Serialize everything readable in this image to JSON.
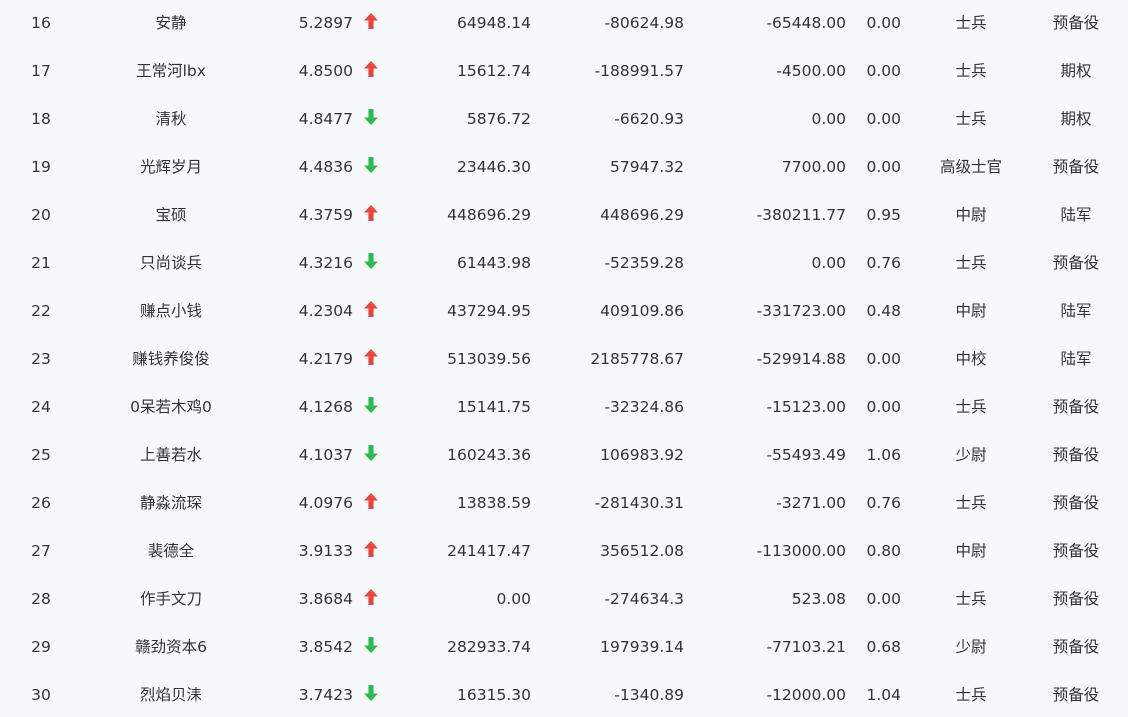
{
  "colors": {
    "up": "#e8473f",
    "down": "#2dbb4e",
    "text": "#333333",
    "background": "#f7f8fa"
  },
  "rows": [
    {
      "rank": "16",
      "name": "安静",
      "score": "5.2897",
      "trend": "up",
      "v1": "64948.14",
      "v2": "-80624.98",
      "v3": "-65448.00",
      "ratio": "0.00",
      "level": "士兵",
      "type": "预备役"
    },
    {
      "rank": "17",
      "name": "王常河lbx",
      "score": "4.8500",
      "trend": "up",
      "v1": "15612.74",
      "v2": "-188991.57",
      "v3": "-4500.00",
      "ratio": "0.00",
      "level": "士兵",
      "type": "期权"
    },
    {
      "rank": "18",
      "name": "清秋",
      "score": "4.8477",
      "trend": "down",
      "v1": "5876.72",
      "v2": "-6620.93",
      "v3": "0.00",
      "ratio": "0.00",
      "level": "士兵",
      "type": "期权"
    },
    {
      "rank": "19",
      "name": "光辉岁月",
      "score": "4.4836",
      "trend": "down",
      "v1": "23446.30",
      "v2": "57947.32",
      "v3": "7700.00",
      "ratio": "0.00",
      "level": "高级士官",
      "type": "预备役"
    },
    {
      "rank": "20",
      "name": "宝硕",
      "score": "4.3759",
      "trend": "up",
      "v1": "448696.29",
      "v2": "448696.29",
      "v3": "-380211.77",
      "ratio": "0.95",
      "level": "中尉",
      "type": "陆军"
    },
    {
      "rank": "21",
      "name": "只尚谈兵",
      "score": "4.3216",
      "trend": "down",
      "v1": "61443.98",
      "v2": "-52359.28",
      "v3": "0.00",
      "ratio": "0.76",
      "level": "士兵",
      "type": "预备役"
    },
    {
      "rank": "22",
      "name": "赚点小钱",
      "score": "4.2304",
      "trend": "up",
      "v1": "437294.95",
      "v2": "409109.86",
      "v3": "-331723.00",
      "ratio": "0.48",
      "level": "中尉",
      "type": "陆军"
    },
    {
      "rank": "23",
      "name": "赚钱养俊俊",
      "score": "4.2179",
      "trend": "up",
      "v1": "513039.56",
      "v2": "2185778.67",
      "v3": "-529914.88",
      "ratio": "0.00",
      "level": "中校",
      "type": "陆军"
    },
    {
      "rank": "24",
      "name": "0呆若木鸡0",
      "score": "4.1268",
      "trend": "down",
      "v1": "15141.75",
      "v2": "-32324.86",
      "v3": "-15123.00",
      "ratio": "0.00",
      "level": "士兵",
      "type": "预备役"
    },
    {
      "rank": "25",
      "name": "上善若水",
      "score": "4.1037",
      "trend": "down",
      "v1": "160243.36",
      "v2": "106983.92",
      "v3": "-55493.49",
      "ratio": "1.06",
      "level": "少尉",
      "type": "预备役"
    },
    {
      "rank": "26",
      "name": "静淼流琛",
      "score": "4.0976",
      "trend": "up",
      "v1": "13838.59",
      "v2": "-281430.31",
      "v3": "-3271.00",
      "ratio": "0.76",
      "level": "士兵",
      "type": "预备役"
    },
    {
      "rank": "27",
      "name": "裴德全",
      "score": "3.9133",
      "trend": "up",
      "v1": "241417.47",
      "v2": "356512.08",
      "v3": "-113000.00",
      "ratio": "0.80",
      "level": "中尉",
      "type": "预备役"
    },
    {
      "rank": "28",
      "name": "作手文刀",
      "score": "3.8684",
      "trend": "up",
      "v1": "0.00",
      "v2": "-274634.3",
      "v3": "523.08",
      "ratio": "0.00",
      "level": "士兵",
      "type": "预备役"
    },
    {
      "rank": "29",
      "name": "赣劲资本6",
      "score": "3.8542",
      "trend": "down",
      "v1": "282933.74",
      "v2": "197939.14",
      "v3": "-77103.21",
      "ratio": "0.68",
      "level": "少尉",
      "type": "预备役"
    },
    {
      "rank": "30",
      "name": "烈焰贝洡",
      "score": "3.7423",
      "trend": "down",
      "v1": "16315.30",
      "v2": "-1340.89",
      "v3": "-12000.00",
      "ratio": "1.04",
      "level": "士兵",
      "type": "预备役"
    }
  ]
}
